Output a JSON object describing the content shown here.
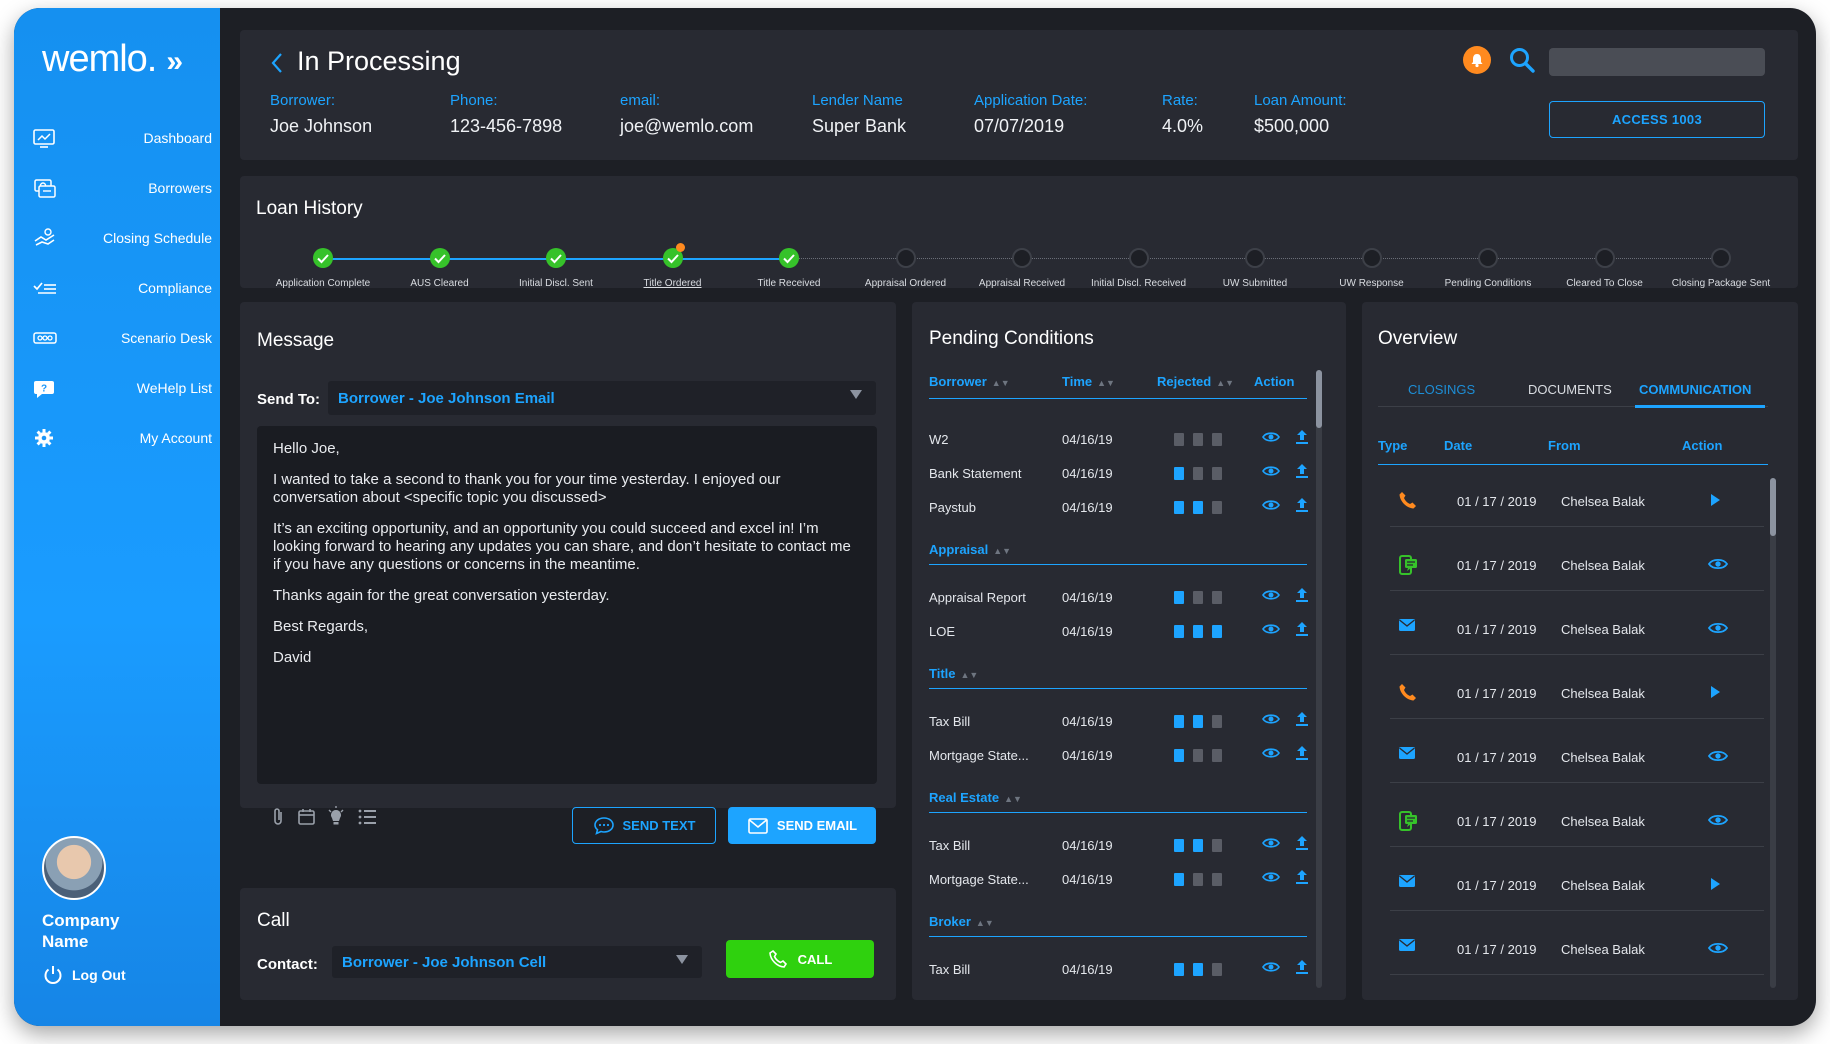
{
  "app": {
    "logo": "wemlo.",
    "logo_chevron": "»"
  },
  "sidebar": {
    "items": [
      {
        "label": "Dashboard",
        "icon": "dashboard-icon"
      },
      {
        "label": "Borrowers",
        "icon": "borrowers-icon"
      },
      {
        "label": "Closing Schedule",
        "icon": "closing-schedule-icon"
      },
      {
        "label": "Compliance",
        "icon": "compliance-icon"
      },
      {
        "label": "Scenario Desk",
        "icon": "scenario-desk-icon"
      },
      {
        "label": "WeHelp List",
        "icon": "help-icon"
      },
      {
        "label": "My Account",
        "icon": "gear-icon"
      }
    ],
    "company": "Company Name",
    "logout": "Log Out"
  },
  "header": {
    "title": "In Processing",
    "fields": [
      {
        "label": "Borrower:",
        "value": "Joe Johnson"
      },
      {
        "label": "Phone:",
        "value": "123-456-7898"
      },
      {
        "label": "email:",
        "value": "joe@wemlo.com"
      },
      {
        "label": "Lender Name",
        "value": "Super Bank"
      },
      {
        "label": "Application Date:",
        "value": "07/07/2019"
      },
      {
        "label": "Rate:",
        "value": "4.0%"
      },
      {
        "label": "Loan Amount:",
        "value": "$500,000"
      }
    ],
    "access_button": "ACCESS 1003"
  },
  "loan_history": {
    "title": "Loan History",
    "steps": [
      {
        "label": "Application Complete",
        "done": true
      },
      {
        "label": "AUS Cleared",
        "done": true
      },
      {
        "label": "Initial Discl. Sent",
        "done": true
      },
      {
        "label": "Title Ordered",
        "done": true,
        "alert": true
      },
      {
        "label": "Title Received",
        "done": true
      },
      {
        "label": "Appraisal Ordered",
        "done": false
      },
      {
        "label": "Appraisal Received",
        "done": false
      },
      {
        "label": "Initial Discl. Received",
        "done": false
      },
      {
        "label": "UW Submitted",
        "done": false
      },
      {
        "label": "UW Response",
        "done": false
      },
      {
        "label": "Pending Conditions",
        "done": false
      },
      {
        "label": "Cleared To Close",
        "done": false
      },
      {
        "label": "Closing Package Sent",
        "done": false
      }
    ]
  },
  "message": {
    "title": "Message",
    "send_to_label": "Send To:",
    "send_to_value": "Borrower - Joe Johnson Email",
    "body": [
      "Hello Joe,",
      "I wanted to take a second to thank you for your time yesterday. I enjoyed our conversation about <specific topic you discussed>",
      "It’s an exciting opportunity, and an opportunity you could succeed and excel in! I’m looking forward to hearing any updates you can share, and don’t hesitate to contact me if you have any questions or concerns in the meantime.",
      "Thanks again for the great conversation yesterday.",
      "Best Regards,",
      "David"
    ],
    "send_text": "SEND TEXT",
    "send_email": "SEND EMAIL"
  },
  "call": {
    "title": "Call",
    "contact_label": "Contact:",
    "contact_value": "Borrower - Joe Johnson Cell",
    "call_button": "CALL"
  },
  "pending": {
    "title": "Pending Conditions",
    "columns": [
      "Borrower",
      "Time",
      "Rejected",
      "Action"
    ],
    "groups": [
      {
        "name": "",
        "rows": [
          {
            "name": "W2",
            "time": "04/16/19",
            "docs": [
              0,
              0,
              0
            ]
          },
          {
            "name": "Bank Statement",
            "time": "04/16/19",
            "docs": [
              1,
              0,
              0
            ]
          },
          {
            "name": "Paystub",
            "time": "04/16/19",
            "docs": [
              1,
              1,
              0
            ]
          }
        ]
      },
      {
        "name": "Appraisal",
        "rows": [
          {
            "name": "Appraisal Report",
            "time": "04/16/19",
            "docs": [
              1,
              0,
              0
            ]
          },
          {
            "name": "LOE",
            "time": "04/16/19",
            "docs": [
              1,
              1,
              1
            ]
          }
        ]
      },
      {
        "name": "Title",
        "rows": [
          {
            "name": "Tax Bill",
            "time": "04/16/19",
            "docs": [
              1,
              1,
              0
            ]
          },
          {
            "name": "Mortgage State...",
            "time": "04/16/19",
            "docs": [
              1,
              0,
              0
            ]
          }
        ]
      },
      {
        "name": "Real Estate",
        "rows": [
          {
            "name": "Tax Bill",
            "time": "04/16/19",
            "docs": [
              1,
              1,
              0
            ]
          },
          {
            "name": "Mortgage State...",
            "time": "04/16/19",
            "docs": [
              1,
              0,
              0
            ]
          }
        ]
      },
      {
        "name": "Broker",
        "rows": [
          {
            "name": "Tax Bill",
            "time": "04/16/19",
            "docs": [
              1,
              1,
              0
            ]
          }
        ]
      }
    ]
  },
  "overview": {
    "title": "Overview",
    "tabs": [
      "CLOSINGS",
      "DOCUMENTS",
      "COMMUNICATION"
    ],
    "active_tab": "COMMUNICATION",
    "columns": [
      "Type",
      "Date",
      "From",
      "Action"
    ],
    "rows": [
      {
        "type": "phone-icon",
        "date": "01 / 17 / 2019",
        "from": "Chelsea Balak",
        "action": "play-icon"
      },
      {
        "type": "sms-icon",
        "date": "01 / 17 / 2019",
        "from": "Chelsea Balak",
        "action": "eye-icon"
      },
      {
        "type": "mail-icon",
        "date": "01 / 17 / 2019",
        "from": "Chelsea Balak",
        "action": "eye-icon"
      },
      {
        "type": "phone-icon",
        "date": "01 / 17 / 2019",
        "from": "Chelsea Balak",
        "action": "play-icon"
      },
      {
        "type": "mail-icon",
        "date": "01 / 17 / 2019",
        "from": "Chelsea Balak",
        "action": "eye-icon"
      },
      {
        "type": "sms-icon",
        "date": "01 / 17 / 2019",
        "from": "Chelsea Balak",
        "action": "eye-icon"
      },
      {
        "type": "mail-icon",
        "date": "01 / 17 / 2019",
        "from": "Chelsea Balak",
        "action": "play-icon"
      },
      {
        "type": "mail-icon",
        "date": "01 / 17 / 2019",
        "from": "Chelsea Balak",
        "action": "eye-icon"
      }
    ]
  },
  "colors": {
    "accent": "#1da4ff",
    "success": "#36c22a",
    "warning": "#ff8a1f",
    "panel": "#282a32",
    "background": "#1d1f25"
  }
}
